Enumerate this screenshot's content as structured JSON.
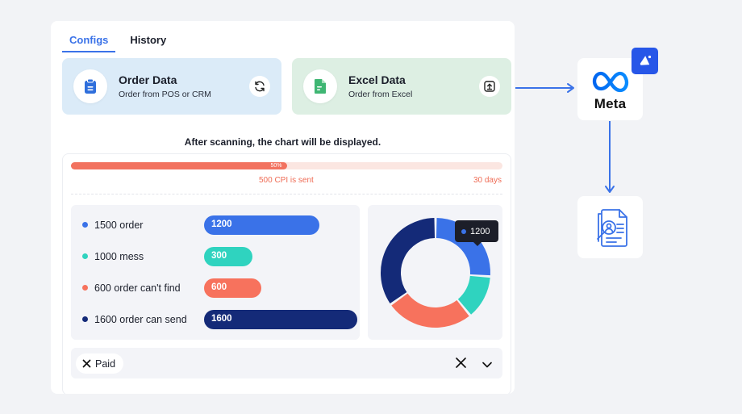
{
  "tabs": [
    {
      "label": "Configs",
      "active": true
    },
    {
      "label": "History",
      "active": false
    }
  ],
  "sources": {
    "order": {
      "title": "Order Data",
      "subtitle": "Order from POS or CRM",
      "icon": "clipboard-icon",
      "action_icon": "refresh-icon",
      "bg": "#dbebf8"
    },
    "excel": {
      "title": "Excel Data",
      "subtitle": "Order from Excel",
      "icon": "spreadsheet-file-icon",
      "action_icon": "upload-icon",
      "bg": "#ddefe3"
    }
  },
  "scan_note": "After scanning, the chart will be displayed.",
  "progress": {
    "percent_label": "50%",
    "value": 0.5,
    "mid_label": "500 CPI is sent",
    "end_label": "30 days",
    "color": "#f2725f"
  },
  "chart_data": {
    "type": "bar",
    "categories": [
      "1500 order",
      "1000 mess",
      "600 order can't find",
      "1600 order can send"
    ],
    "values": [
      1200,
      300,
      600,
      1600
    ],
    "value_labels": [
      "1200",
      "300",
      "600",
      "1600"
    ],
    "colors": [
      "#3a72e8",
      "#2fd3bf",
      "#f7725d",
      "#142a78"
    ],
    "max": 1600,
    "donut": {
      "type": "pie",
      "values": [
        1200,
        600,
        1200,
        1600
      ],
      "colors": [
        "#3a72e8",
        "#2fd3bf",
        "#f7725d",
        "#142a78"
      ],
      "tooltip": "1200"
    }
  },
  "filter": {
    "chip_label": "Paid",
    "chip_icon": "close-icon",
    "clear_icon": "close-icon",
    "expand_icon": "chevron-down-icon"
  },
  "integration": {
    "meta_label": "Meta",
    "meta_icon": "meta-infinity-icon",
    "badge_icon": "megaphone-icon",
    "report_icon": "document-search-icon",
    "accent": "#3a72e8"
  }
}
